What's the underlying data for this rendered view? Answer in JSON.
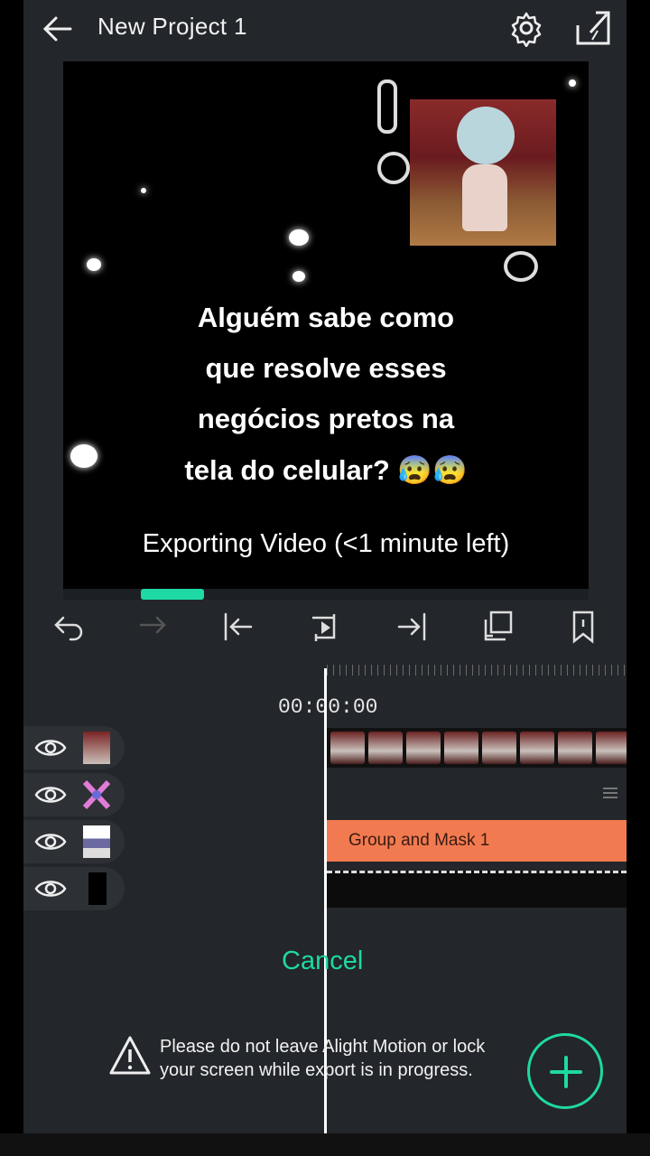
{
  "header": {
    "title": "New Project 1",
    "back_icon": "arrow-left-icon",
    "settings_icon": "gear-icon",
    "export_icon": "export-share-icon"
  },
  "preview": {
    "caption_lines": [
      "Alguém sabe como",
      "que resolve esses",
      "negócios pretos na",
      "tela do celular? 😰😰"
    ],
    "export_status": "Exporting Video (<1 minute left)",
    "export_progress_fraction": 0.12
  },
  "toolbar": {
    "icons": [
      "undo-icon",
      "redo-icon",
      "jump-to-start-icon",
      "play-loop-icon",
      "jump-to-end-icon",
      "duplicate-icon",
      "bookmark-icon"
    ]
  },
  "timeline": {
    "timecode": "00:00:00",
    "group_clip_label": "Group and Mask 1"
  },
  "export_dialog": {
    "cancel_label": "Cancel",
    "warning_line1": "Please do not leave Alight Motion or lock",
    "warning_line2": "your screen while export is in progress."
  },
  "colors": {
    "accent": "#1ed9a3",
    "group_clip": "#f27a50",
    "panel_bg": "#23262a"
  }
}
